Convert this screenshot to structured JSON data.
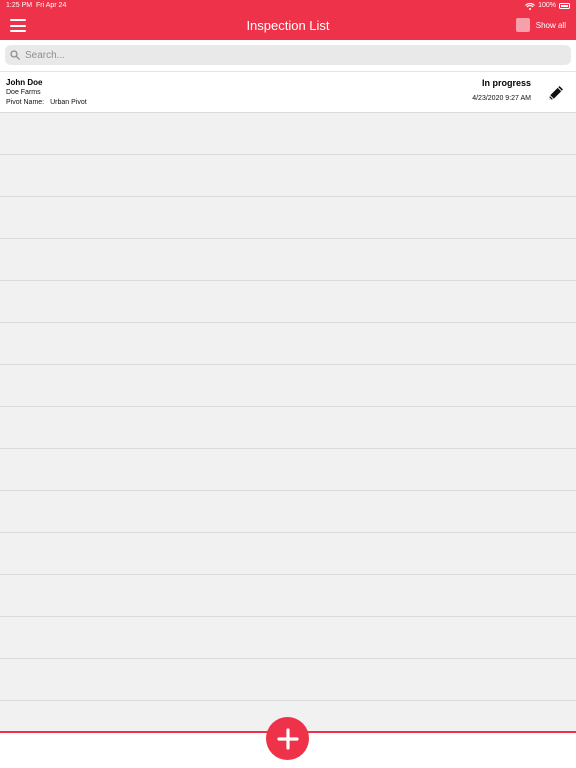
{
  "status_bar": {
    "time": "1:25 PM",
    "date": "Fri Apr 24",
    "battery": "100%"
  },
  "nav": {
    "title": "Inspection List",
    "show_all_label": "Show all"
  },
  "search": {
    "placeholder": "Search..."
  },
  "inspections": [
    {
      "name": "John Doe",
      "farm": "Doe Farms",
      "pivot_label": "Pivot Name:",
      "pivot_value": "Urban Pivot",
      "status": "In progress",
      "datetime": "4/23/2020 9:27 AM"
    }
  ],
  "empty_rows": 15,
  "colors": {
    "accent": "#ee3249",
    "background": "#f1f1f1"
  },
  "icons": {
    "menu": "hamburger-icon",
    "edit": "pencil-icon",
    "add": "plus-icon",
    "search": "magnifier-icon"
  }
}
